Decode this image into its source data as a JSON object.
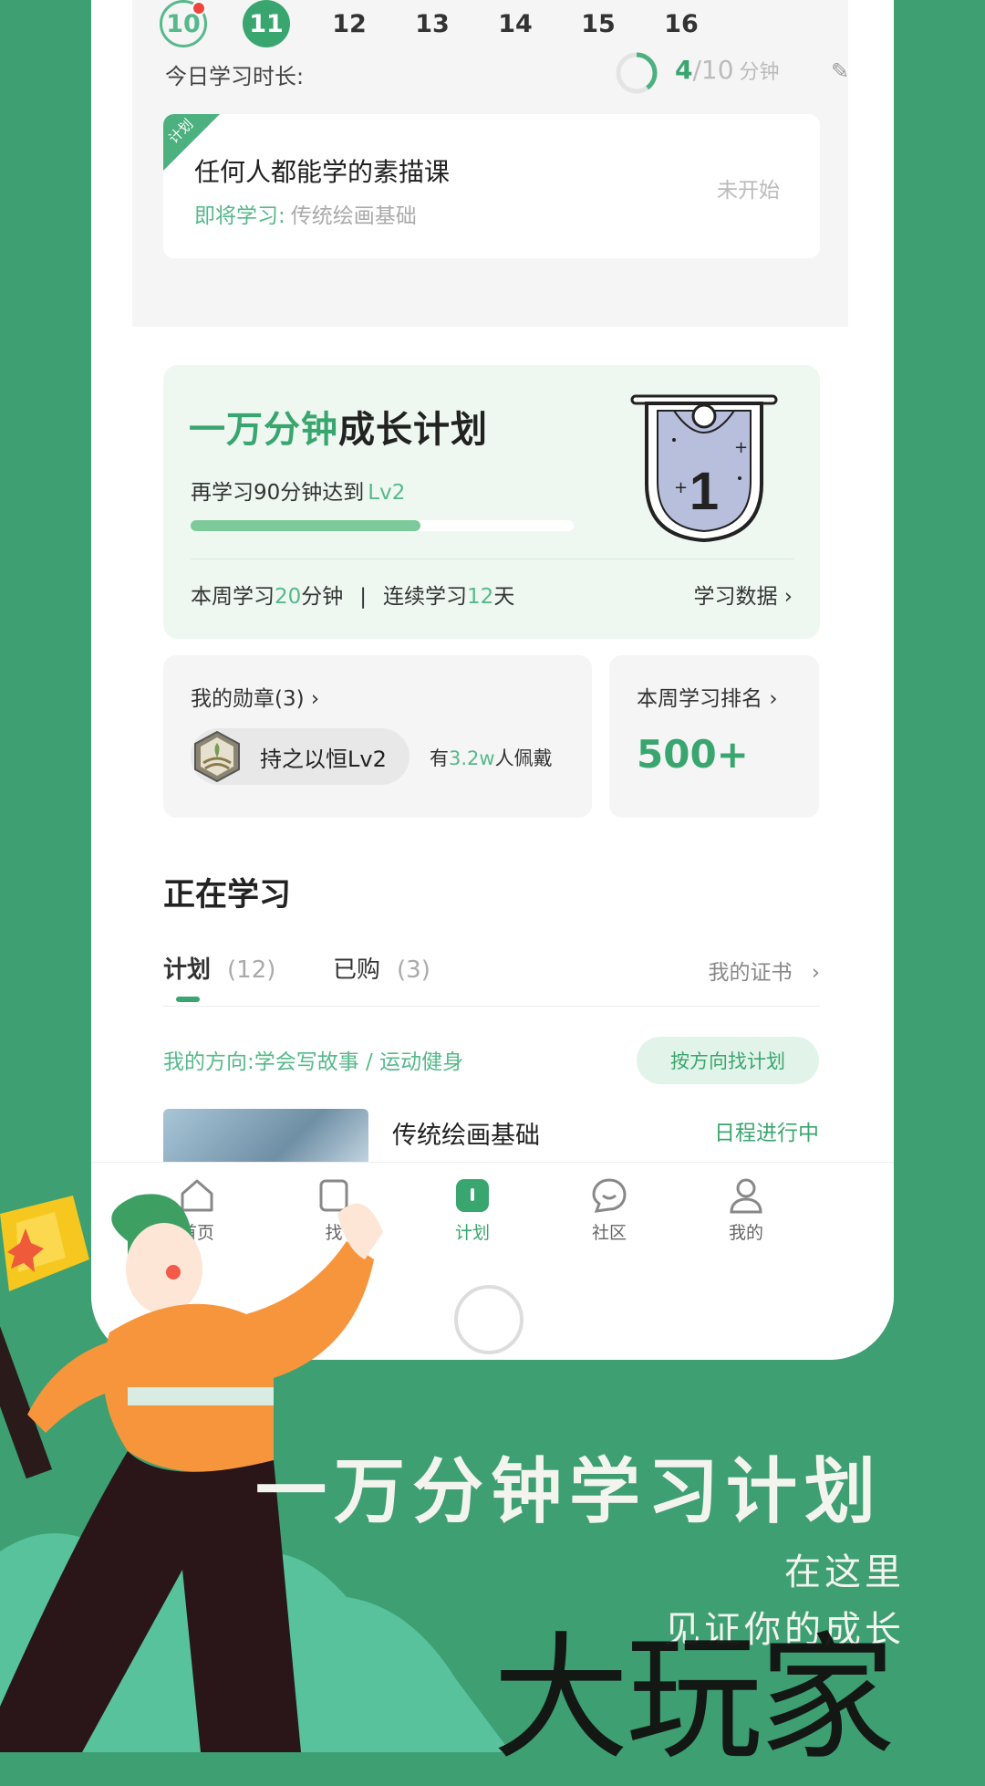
{
  "calendar": {
    "dates": [
      "10",
      "11",
      "12",
      "13",
      "14",
      "15",
      "16"
    ],
    "today_index": 0,
    "selected_index": 1
  },
  "today": {
    "label": "今日学习时长:",
    "current": "4",
    "target": "/10",
    "unit": "分钟",
    "progress_fraction": 0.4
  },
  "plan_card": {
    "tag": "计划",
    "title": "任何人都能学的素描课",
    "next_label": "即将学习:",
    "next_course": "传统绘画基础",
    "status": "未开始"
  },
  "growth": {
    "title_green": "一万分钟",
    "title_dark": "成长计划",
    "sub_prefix": "再学习90分钟达到",
    "sub_level": "Lv2",
    "progress_fraction": 0.6,
    "badge_level": "1",
    "stats_week_prefix": "本周学习",
    "stats_week_value": "20",
    "stats_week_suffix": "分钟",
    "stats_sep": "|",
    "stats_streak_prefix": "连续学习",
    "stats_streak_value": "12",
    "stats_streak_suffix": "天",
    "data_link": "学习数据"
  },
  "medals": {
    "title": "我的勋章(3)",
    "medal_name": "持之以恒Lv2",
    "wear_prefix": "有",
    "wear_count": "3.2w",
    "wear_suffix": "人佩戴"
  },
  "rank": {
    "title": "本周学习排名",
    "value": "500+"
  },
  "learning": {
    "heading": "正在学习",
    "tabs": [
      {
        "label": "计划",
        "count": "(12)"
      },
      {
        "label": "已购",
        "count": "(3)"
      }
    ],
    "cert_link": "我的证书",
    "direction": "我的方向:学会写故事 / 运动健身",
    "direction_button": "按方向找计划",
    "course_name": "传统绘画基础",
    "course_state": "日程进行中"
  },
  "tabbar": {
    "items": [
      {
        "label": "首页"
      },
      {
        "label": "找"
      },
      {
        "label": "计划"
      },
      {
        "label": "社区"
      },
      {
        "label": "我的"
      }
    ],
    "active_index": 2
  },
  "promo": {
    "headline": "一万分钟学习计划",
    "tagline1": "在这里",
    "tagline2": "见证你的成长",
    "watermark": "大玩家"
  },
  "colors": {
    "background": "#3d9f72",
    "accent": "#3aa66f",
    "accent_light": "#55b98a"
  }
}
